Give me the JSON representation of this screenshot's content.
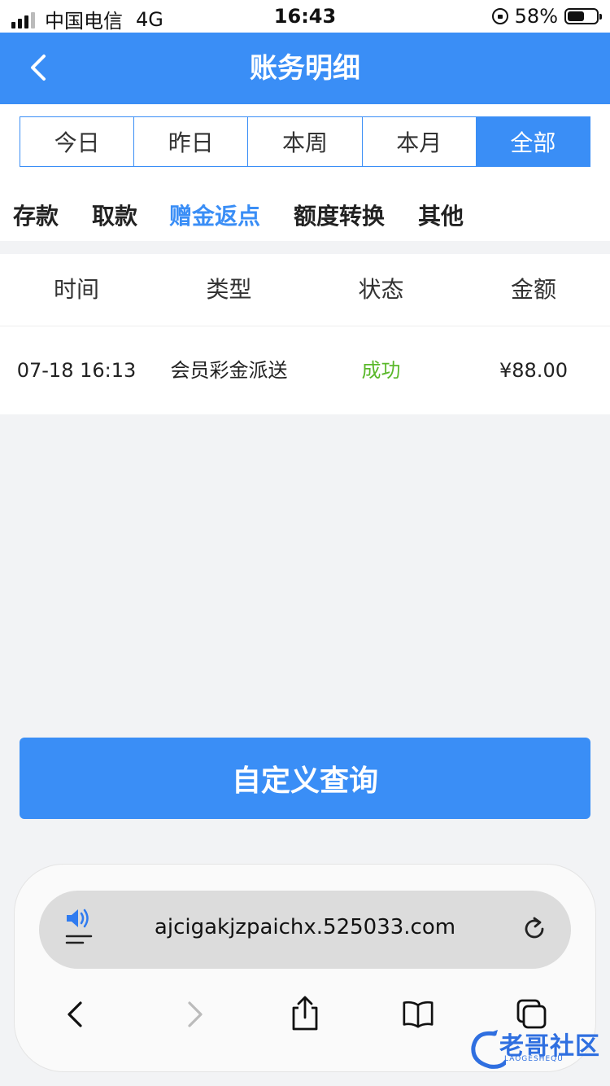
{
  "status_bar": {
    "carrier": "中国电信",
    "network": "4G",
    "time": "16:43",
    "battery": "58%",
    "battery_level": 0.58
  },
  "header": {
    "title": "账务明细"
  },
  "date_tabs": [
    "今日",
    "昨日",
    "本周",
    "本月",
    "全部"
  ],
  "date_tab_active": "全部",
  "type_tabs": [
    "存款",
    "取款",
    "赠金返点",
    "额度转换",
    "其他"
  ],
  "type_tab_active": "赠金返点",
  "table": {
    "columns": [
      "时间",
      "类型",
      "状态",
      "金额"
    ],
    "rows": [
      {
        "time": "07-18 16:13",
        "type": "会员彩金派送",
        "status": "成功",
        "amount": "¥88.00"
      }
    ]
  },
  "query_button": "自定义查询",
  "browser": {
    "url": "ajcigakjzpaichx.525033.com"
  },
  "watermark": {
    "title": "老哥社区",
    "subtitle": "LAOGESHEQU"
  },
  "colors": {
    "accent": "#3a8ef6",
    "success": "#5ab82a"
  }
}
